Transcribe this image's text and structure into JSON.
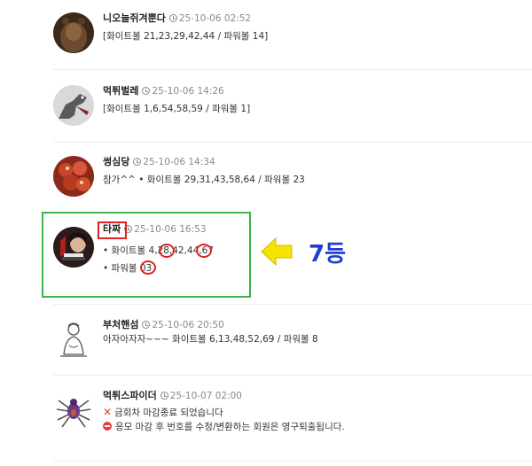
{
  "comments": [
    {
      "author": "니오늘쥐겨뿐다",
      "date": "25-10-06 02:52",
      "line1": "[화이트볼 21,23,29,42,44 / 파워볼 14]"
    },
    {
      "author": "먹튀벌레",
      "date": "25-10-06 14:26",
      "line1": "[화이트볼 1,6,54,58,59 / 파워볼 1]"
    },
    {
      "author": "썽심당",
      "date": "25-10-06 14:34",
      "line1": "참가^^ • 화이트볼 29,31,43,58,64 / 파워볼 23"
    },
    {
      "author": "타짜",
      "date": "25-10-06 16:53",
      "line1": "• 화이트볼 4,28,42,44,67",
      "line2": "• 파워볼 03"
    },
    {
      "author": "부처핸섬",
      "date": "25-10-06 20:50",
      "line1": "아자아자자~~~ 화이트볼 6,13,48,52,69 / 파워볼 8"
    },
    {
      "author": "먹튀스파이더",
      "date": "25-10-07 02:00",
      "line1": "금회차 마감종료 되었습니다",
      "line2": "응모 마감 후 번호를 수정/변환하는 회원은 영구퇴출됩니다."
    }
  ],
  "annotation": {
    "rank_label": "7등"
  },
  "colors": {
    "highlight_box": "#3cb44b",
    "circle": "#e02020",
    "rank_text": "#1f3fd1",
    "arrow": "#f5e400"
  }
}
